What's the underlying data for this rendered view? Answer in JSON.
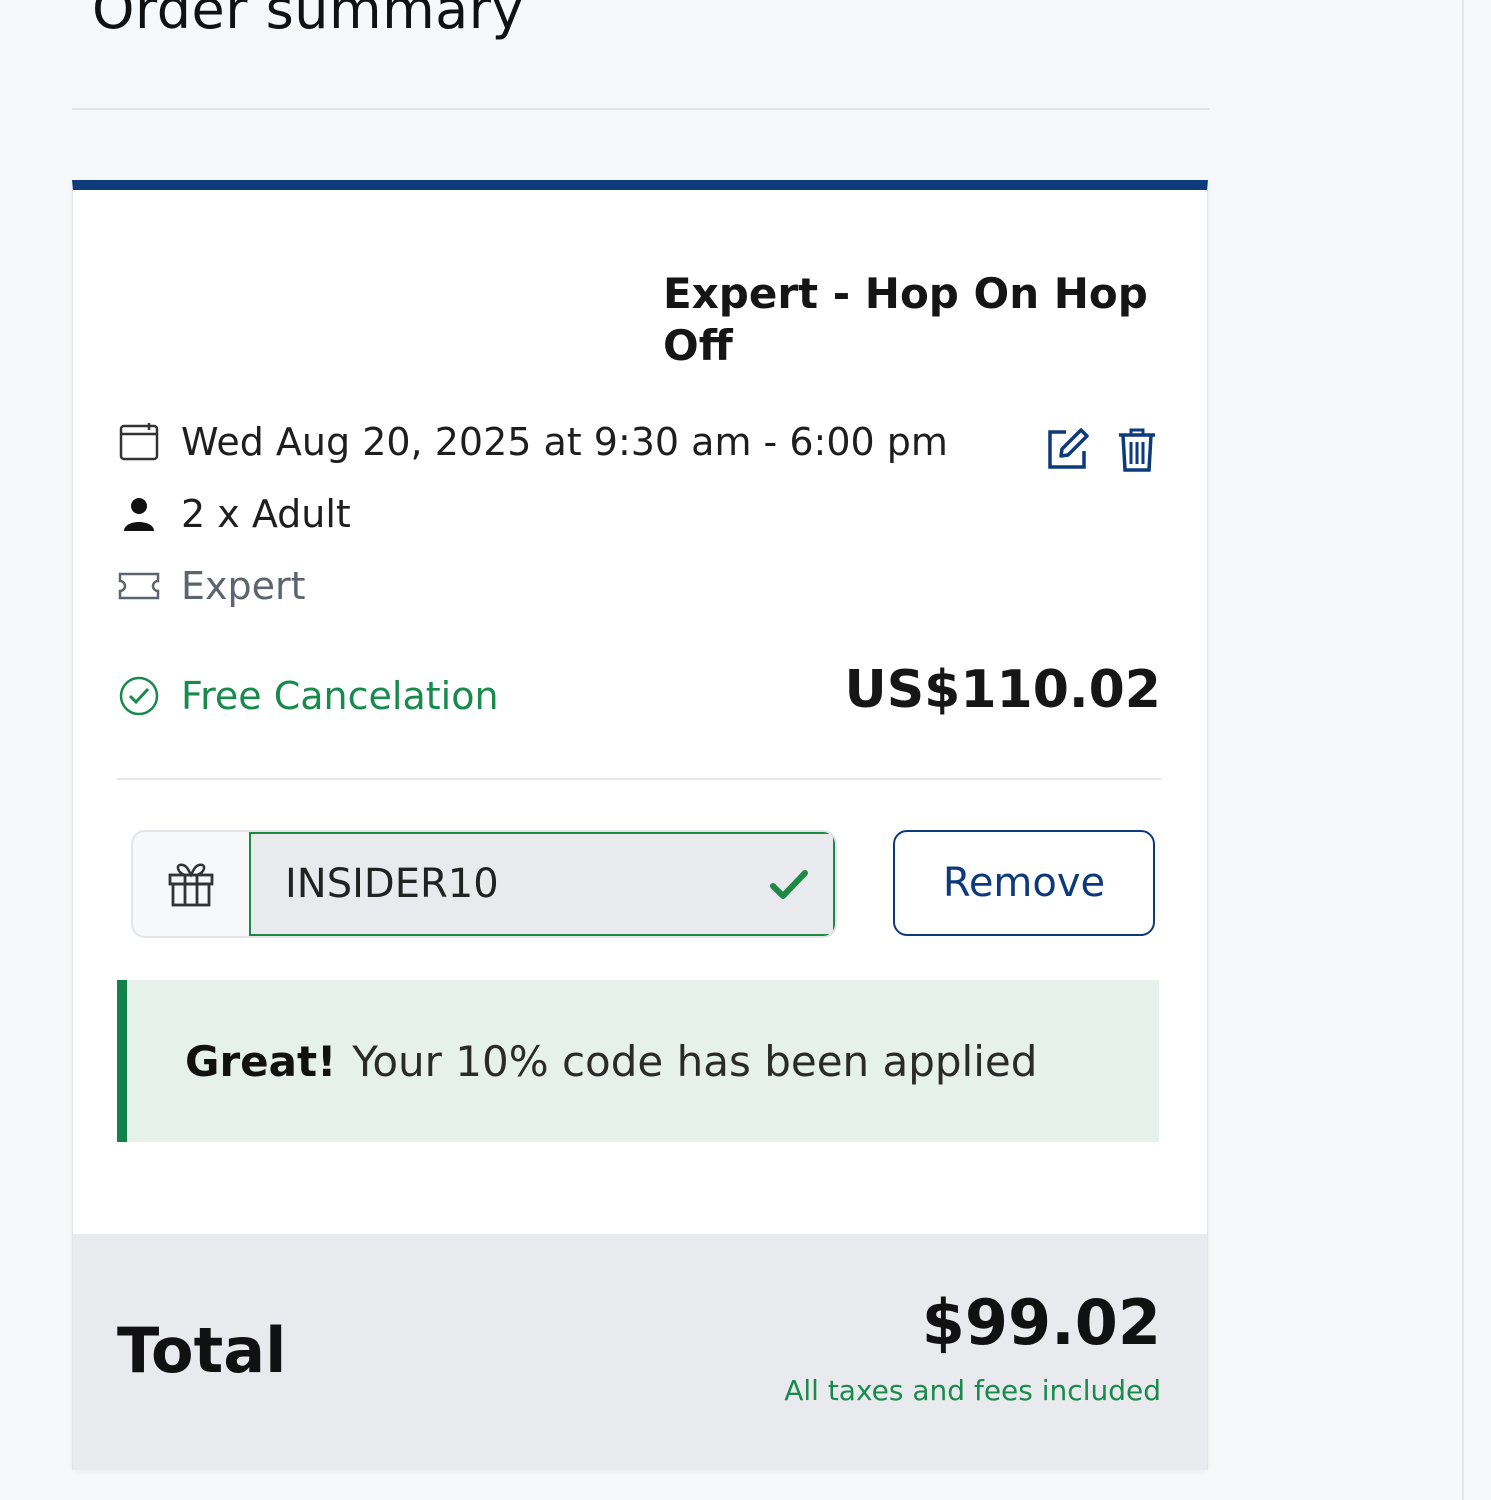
{
  "page": {
    "heading": "Order summary"
  },
  "item": {
    "title": "Expert - Hop On Hop Off",
    "date_time": "Wed Aug 20, 2025 at 9:30 am - 6:00 pm",
    "tickets": "2 x Adult",
    "variant": "Expert",
    "cancellation": "Free Cancelation",
    "price": "US$110.02"
  },
  "promo": {
    "code": "INSIDER10",
    "remove_label": "Remove",
    "success_strong": "Great!",
    "success_text": "Your 10% code has been applied"
  },
  "total": {
    "label": "Total",
    "amount": "$99.02",
    "note": "All taxes and fees included"
  },
  "colors": {
    "brand_navy": "#0d3a7c",
    "success_green": "#188a4c",
    "success_bg": "#e6f1ec",
    "total_bg": "#e9eaee"
  },
  "icons": [
    "calendar-icon",
    "person-icon",
    "ticket-icon",
    "check-circle-icon",
    "edit-icon",
    "trash-icon",
    "gift-icon",
    "check-icon"
  ]
}
